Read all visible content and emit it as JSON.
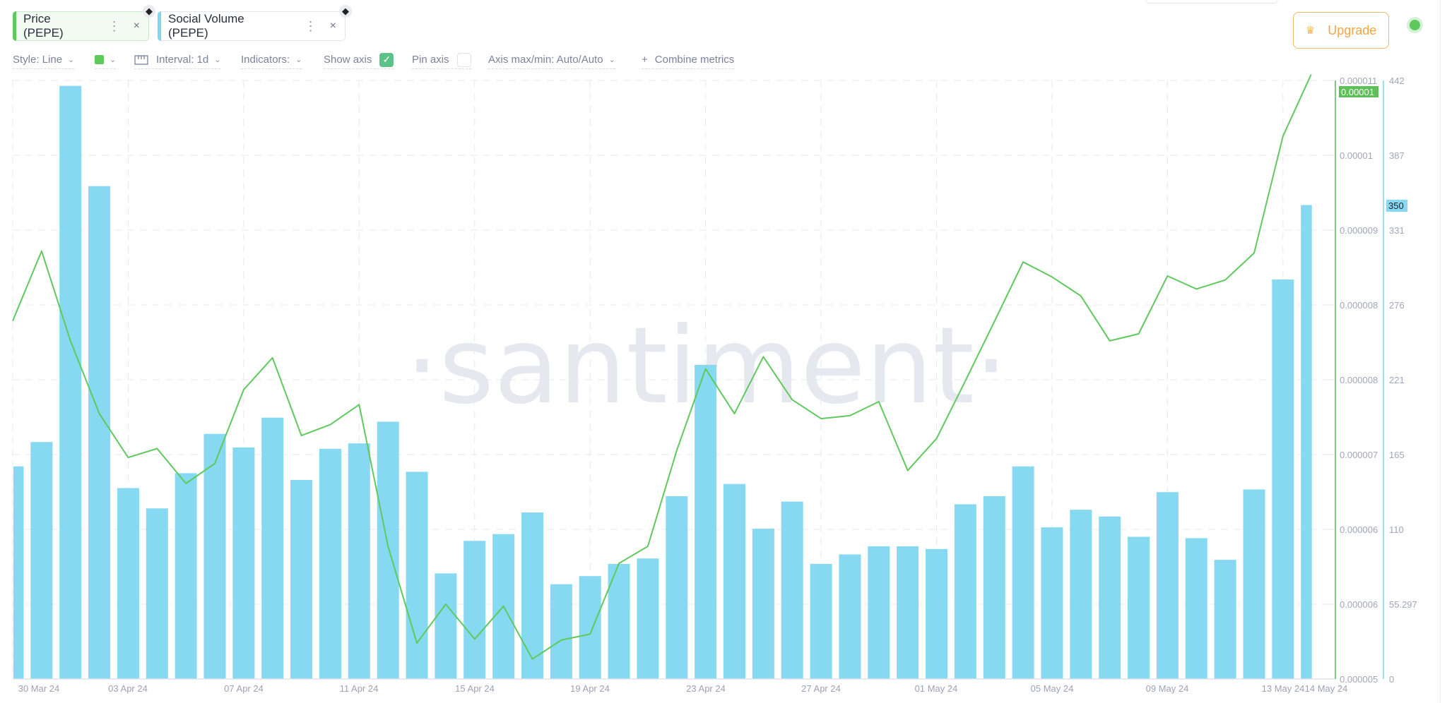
{
  "metrics": [
    {
      "label": "Price (PEPE)",
      "color": "#5fc95d",
      "dots": "⋮",
      "close": "×",
      "chain_icon": "◆"
    },
    {
      "label": "Social Volume (PEPE)",
      "color": "#7fd6ef",
      "dots": "⋮",
      "close": "×",
      "chain_icon": "◆"
    }
  ],
  "toolbar": {
    "style": "Style: Line",
    "interval": "Interval: 1d",
    "indicators": "Indicators:",
    "show_axis": "Show axis",
    "show_axis_checked": true,
    "pin_axis": "Pin axis",
    "pin_axis_checked": false,
    "axis_maxmin": "Axis max/min: Auto/Auto",
    "combine": "Combine metrics",
    "plus": "+",
    "chevron": "⌄",
    "check": "✓"
  },
  "upgrade": {
    "label": "Upgrade",
    "icon": "♛"
  },
  "watermark": "·santiment·",
  "chart_data": {
    "type": "bar",
    "title": "",
    "xlabel": "",
    "categories": [
      "30 Mar 24",
      "31 Mar 24",
      "01 Apr 24",
      "02 Apr 24",
      "03 Apr 24",
      "04 Apr 24",
      "05 Apr 24",
      "06 Apr 24",
      "07 Apr 24",
      "08 Apr 24",
      "09 Apr 24",
      "10 Apr 24",
      "11 Apr 24",
      "12 Apr 24",
      "13 Apr 24",
      "14 Apr 24",
      "15 Apr 24",
      "16 Apr 24",
      "17 Apr 24",
      "18 Apr 24",
      "19 Apr 24",
      "20 Apr 24",
      "21 Apr 24",
      "22 Apr 24",
      "23 Apr 24",
      "24 Apr 24",
      "25 Apr 24",
      "26 Apr 24",
      "27 Apr 24",
      "28 Apr 24",
      "29 Apr 24",
      "30 Apr 24",
      "01 May 24",
      "02 May 24",
      "03 May 24",
      "04 May 24",
      "05 May 24",
      "06 May 24",
      "07 May 24",
      "08 May 24",
      "09 May 24",
      "10 May 24",
      "11 May 24",
      "12 May 24",
      "13 May 24",
      "14 May 24"
    ],
    "x_tick_labels": [
      "30 Mar 24",
      "03 Apr 24",
      "07 Apr 24",
      "11 Apr 24",
      "15 Apr 24",
      "19 Apr 24",
      "23 Apr 24",
      "27 Apr 24",
      "01 May 24",
      "05 May 24",
      "09 May 24",
      "13 May 24",
      "14 May 24"
    ],
    "series": [
      {
        "name": "Social Volume (PEPE)",
        "type": "bar",
        "color": "#86d9f0",
        "axis": "right",
        "values": [
          157,
          175,
          438,
          364,
          141,
          126,
          152,
          181,
          171,
          193,
          147,
          170,
          174,
          190,
          153,
          78,
          102,
          107,
          123,
          70,
          76,
          85,
          89,
          135,
          232,
          144,
          111,
          131,
          85,
          92,
          98,
          98,
          96,
          129,
          135,
          157,
          112,
          125,
          120,
          105,
          138,
          104,
          88,
          140,
          295,
          350
        ]
      },
      {
        "name": "Price (PEPE)",
        "type": "line",
        "color": "#5fc95d",
        "axis": "left",
        "values": [
          8.59e-06,
          9.29e-06,
          8.39e-06,
          7.66e-06,
          7.22e-06,
          7.31e-06,
          6.96e-06,
          7.16e-06,
          7.9e-06,
          8.22e-06,
          7.44e-06,
          7.55e-06,
          7.75e-06,
          6.33e-06,
          5.36e-06,
          5.75e-06,
          5.4e-06,
          5.73e-06,
          5.2e-06,
          5.39e-06,
          5.45e-06,
          6.16e-06,
          6.33e-06,
          7.29e-06,
          8.11e-06,
          7.66e-06,
          8.23e-06,
          7.8e-06,
          7.61e-06,
          7.64e-06,
          7.78e-06,
          7.09e-06,
          7.41e-06,
          7.99e-06,
          8.58e-06,
          9.18e-06,
          9.03e-06,
          8.84e-06,
          8.39e-06,
          8.46e-06,
          9.04e-06,
          8.91e-06,
          9e-06,
          9.27e-06,
          1.044e-05,
          1.106e-05
        ]
      }
    ],
    "y_left": {
      "ticks": [
        "0.000011",
        "0.00001",
        "0.000009",
        "0.000008",
        "0.000008",
        "0.000007",
        "0.000006",
        "0.000006",
        "0.000005"
      ],
      "range": [
        5e-06,
        1.1e-05
      ],
      "current_label": "0.00001",
      "color": "#5fc95d"
    },
    "y_right": {
      "ticks": [
        "442",
        "387",
        "331",
        "276",
        "221",
        "165",
        "110",
        "55.297",
        "0"
      ],
      "range": [
        0,
        442
      ],
      "current_label": "350",
      "color": "#86d9f0"
    },
    "grid": true,
    "legend": "top-left"
  }
}
